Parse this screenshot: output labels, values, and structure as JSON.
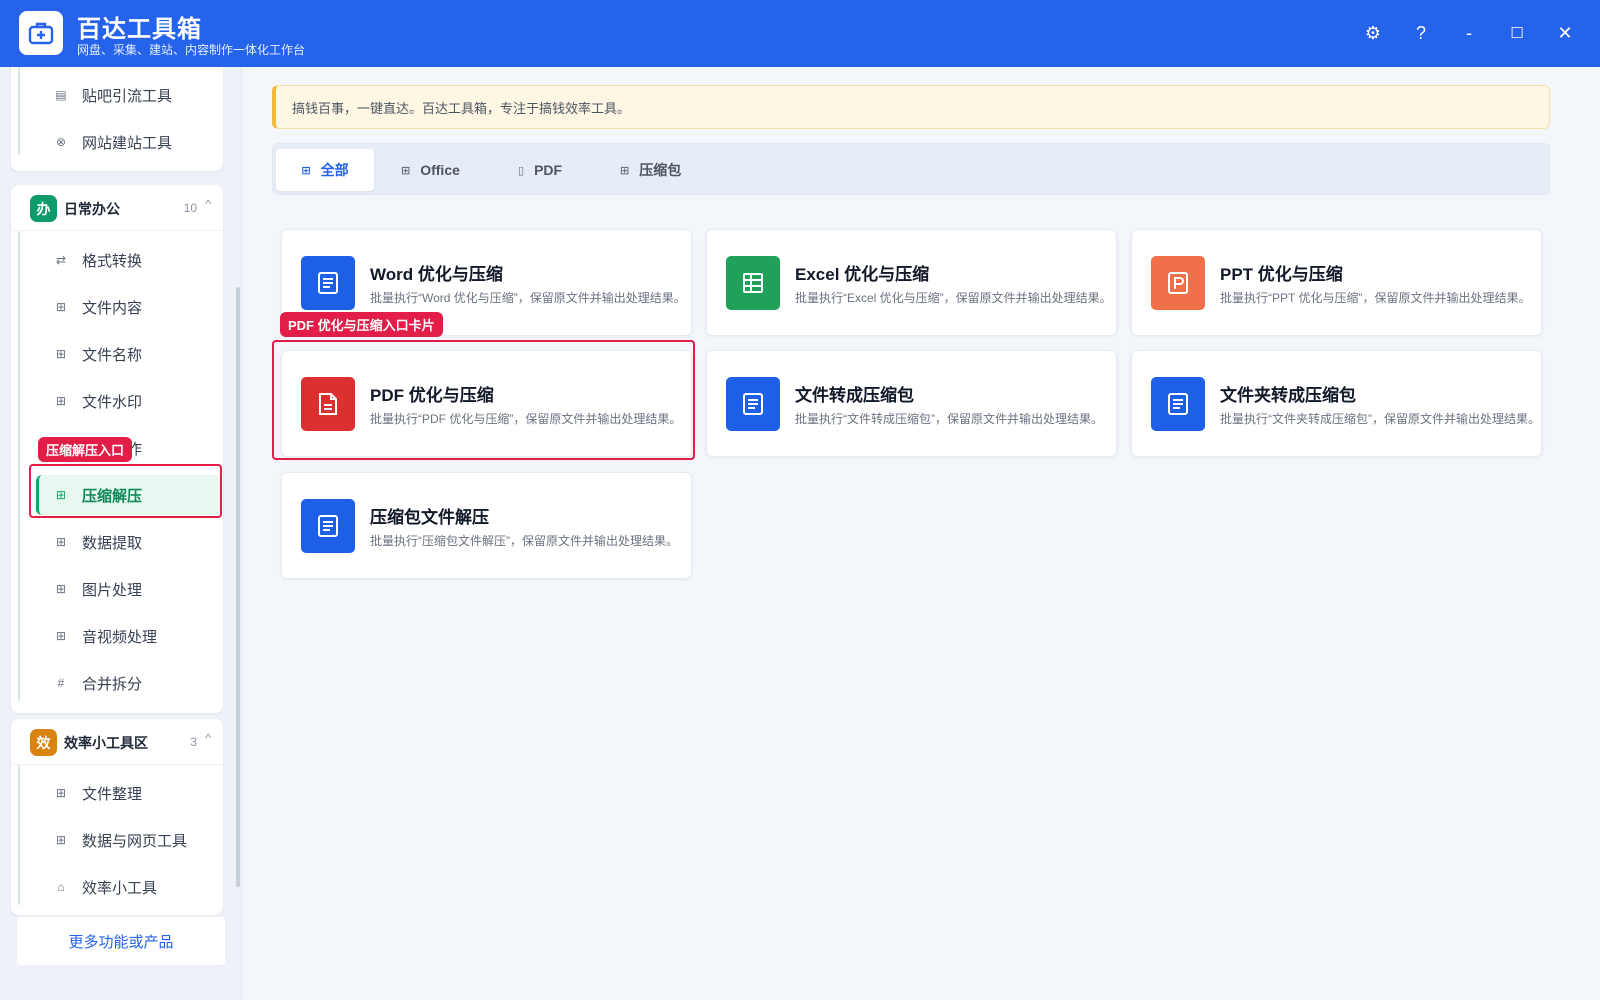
{
  "app": {
    "title": "百达工具箱",
    "subtitle": "网盘、采集、建站、内容制作一体化工作台"
  },
  "window_controls": {
    "settings": "⚙",
    "help": "?",
    "minimize": "-",
    "maximize": "☐",
    "close": "✕"
  },
  "sidebar": {
    "top_group_items": [
      {
        "label": "贴吧引流工具",
        "icon": "list-icon"
      },
      {
        "label": "网站建站工具",
        "icon": "globe-icon"
      }
    ],
    "office_group": {
      "badge": "办",
      "title": "日常办公",
      "count": "10",
      "caret": "^",
      "items": [
        {
          "label": "格式转换",
          "icon": "swap-icon"
        },
        {
          "label": "文件内容",
          "icon": "grid-icon"
        },
        {
          "label": "文件名称",
          "icon": "grid-icon"
        },
        {
          "label": "文件水印",
          "icon": "grid-icon"
        },
        {
          "label": "文件操作",
          "icon": "grid-icon"
        },
        {
          "label": "压缩解压",
          "icon": "grid-icon",
          "active": true
        },
        {
          "label": "数据提取",
          "icon": "grid-icon"
        },
        {
          "label": "图片处理",
          "icon": "grid-icon"
        },
        {
          "label": "音视频处理",
          "icon": "grid-icon"
        },
        {
          "label": "合并拆分",
          "icon": "hash-icon"
        }
      ]
    },
    "efficiency_group": {
      "badge": "效",
      "title": "效率小工具区",
      "count": "3",
      "caret": "^",
      "items": [
        {
          "label": "文件整理",
          "icon": "grid-icon"
        },
        {
          "label": "数据与网页工具",
          "icon": "grid-icon"
        },
        {
          "label": "效率小工具",
          "icon": "toolbox-icon"
        }
      ]
    },
    "more_link": "更多功能或产品",
    "highlight_tag": "压缩解压入口"
  },
  "main": {
    "notice": "搞钱百事，一键直达。百达工具箱，专注于搞钱效率工具。",
    "tabs": [
      {
        "label": "全部",
        "icon": "grid-icon",
        "active": true
      },
      {
        "label": "Office",
        "icon": "grid-icon"
      },
      {
        "label": "PDF",
        "icon": "file-icon"
      },
      {
        "label": "压缩包",
        "icon": "grid-icon"
      }
    ],
    "card_highlight_tag": "PDF 优化与压缩入口卡片",
    "cards": [
      {
        "title": "Word 优化与压缩",
        "desc": "批量执行“Word 优化与压缩”，保留原文件并输出处理结果。",
        "color": "#1d5fe6",
        "icon": "document-icon"
      },
      {
        "title": "Excel 优化与压缩",
        "desc": "批量执行“Excel 优化与压缩”，保留原文件并输出处理结果。",
        "color": "#1fa15a",
        "icon": "spreadsheet-icon"
      },
      {
        "title": "PPT 优化与压缩",
        "desc": "批量执行“PPT 优化与压缩”，保留原文件并输出处理结果。",
        "color": "#f0704a",
        "icon": "presentation-icon"
      },
      {
        "title": "PDF 优化与压缩",
        "desc": "批量执行“PDF 优化与压缩”，保留原文件并输出处理结果。",
        "color": "#dc2f2f",
        "icon": "pdf-file-icon"
      },
      {
        "title": "文件转成压缩包",
        "desc": "批量执行“文件转成压缩包”，保留原文件并输出处理结果。",
        "color": "#1d5fe6",
        "icon": "document-icon"
      },
      {
        "title": "文件夹转成压缩包",
        "desc": "批量执行“文件夹转成压缩包”，保留原文件并输出处理结果。",
        "color": "#1d5fe6",
        "icon": "document-icon"
      },
      {
        "title": "压缩包文件解压",
        "desc": "批量执行“压缩包文件解压”，保留原文件并输出处理结果。",
        "color": "#1d5fe6",
        "icon": "document-icon"
      }
    ]
  },
  "colors": {
    "brand": "#2563eb",
    "active_green": "#10a66a",
    "highlight_red": "#e11d48",
    "office_badge": "#0f9a6b",
    "efficiency_badge": "#d98412"
  }
}
